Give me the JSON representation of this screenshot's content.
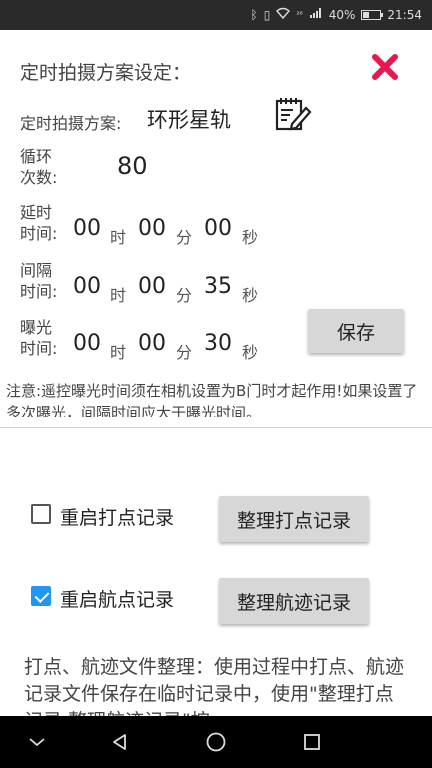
{
  "status_bar": {
    "network": "²⁶",
    "battery": "40%",
    "battery_level": 0.4,
    "time": "21:54"
  },
  "settings": {
    "title": "定时拍摄方案设定：",
    "plan_label": "定时拍摄方案:",
    "plan_value": "环形星轨",
    "cycle": {
      "label_line1": "循环",
      "label_line2": "次数:",
      "value": "80"
    },
    "delay": {
      "label_line1": "延时",
      "label_line2": "时间:",
      "hours": "00",
      "minutes": "00",
      "seconds": "00"
    },
    "interval": {
      "label_line1": "间隔",
      "label_line2": "时间:",
      "hours": "00",
      "minutes": "00",
      "seconds": "35"
    },
    "exposure": {
      "label_line1": "曝光",
      "label_line2": "时间:",
      "hours": "00",
      "minutes": "00",
      "seconds": "30"
    },
    "units": {
      "hour": "时",
      "minute": "分",
      "second": "秒"
    },
    "save_label": "保存",
    "notice": "注意:遥控曝光时间须在相机设置为B门时才起作用!如果设置了多次曝光，间隔时间应大于曝光时间。"
  },
  "records": {
    "point_checkbox_label": "重启打点记录",
    "point_checked": false,
    "point_button": "整理打点记录",
    "track_checkbox_label": "重启航点记录",
    "track_checked": true,
    "track_button": "整理航迹记录",
    "description": "打点、航迹文件整理：使用过程中打点、航迹记录文件保存在临时记录中，使用\"整理打点记录,整理航迹记录\"按"
  },
  "colors": {
    "close_icon": "#e8174f",
    "checkbox_checked": "#2196f3"
  }
}
